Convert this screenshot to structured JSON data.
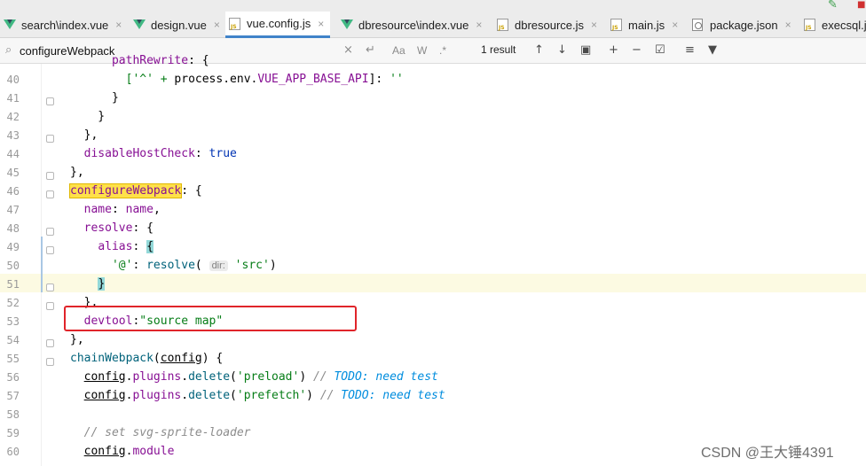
{
  "tabs": [
    {
      "label": "search\\index.vue",
      "icon": "vue-icon",
      "active": false
    },
    {
      "label": "design.vue",
      "icon": "vue-icon",
      "active": false
    },
    {
      "label": "vue.config.js",
      "icon": "js-icon",
      "active": true
    },
    {
      "label": "dbresource\\index.vue",
      "icon": "vue-icon",
      "active": false
    },
    {
      "label": "dbresource.js",
      "icon": "js-icon",
      "active": false
    },
    {
      "label": "main.js",
      "icon": "js-icon",
      "active": false
    },
    {
      "label": "package.json",
      "icon": "package-icon",
      "active": false
    },
    {
      "label": "execsql.js",
      "icon": "js-icon",
      "active": false
    }
  ],
  "close_glyph": "×",
  "search": {
    "query": "configureWebpack",
    "result_count": "1 result",
    "match_case_label": "Aa",
    "words_label": "W",
    "regex_label": ".*"
  },
  "editor": {
    "line_numbers": [
      "40",
      "41",
      "42",
      "43",
      "44",
      "45",
      "46",
      "47",
      "48",
      "49",
      "50",
      "51",
      "52",
      "53",
      "54",
      "55",
      "56",
      "57",
      "58",
      "59",
      "60"
    ],
    "inlay_hint": "dir:",
    "highlight_line": "51",
    "accent_colors": {
      "search_match": "#ffe14a",
      "brace_match": "#93d9d9",
      "annotation_box": "#e0242a",
      "active_tab": "#4083c9"
    }
  },
  "watermark": "CSDN @王大锤4391"
}
